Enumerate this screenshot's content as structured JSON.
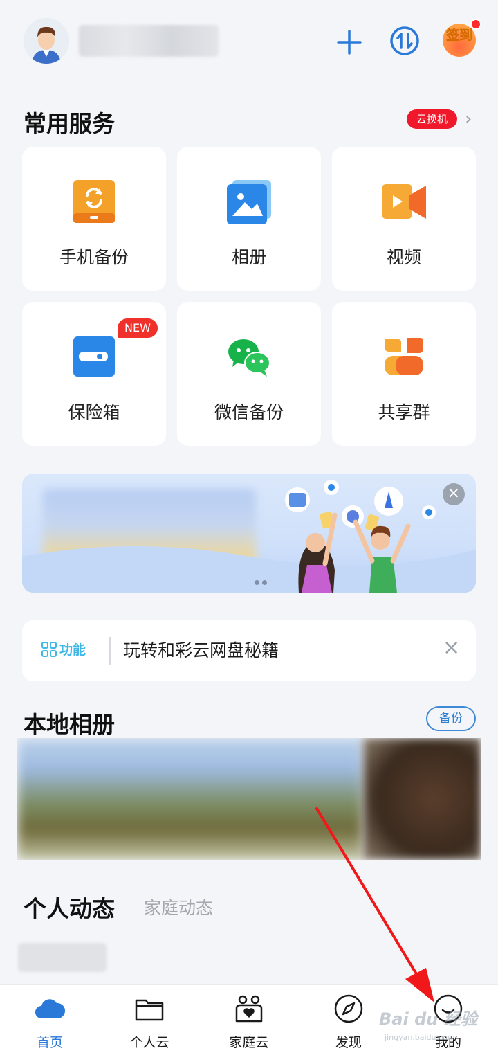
{
  "header": {
    "sign_label": "签到"
  },
  "services": {
    "title": "常用服务",
    "badge": "云换机",
    "items": [
      {
        "label": "手机备份",
        "icon": "phone-backup-icon"
      },
      {
        "label": "相册",
        "icon": "album-icon"
      },
      {
        "label": "视频",
        "icon": "video-icon"
      },
      {
        "label": "保险箱",
        "icon": "safe-icon",
        "badge": "NEW"
      },
      {
        "label": "微信备份",
        "icon": "wechat-icon"
      },
      {
        "label": "共享群",
        "icon": "share-group-icon"
      }
    ]
  },
  "tip": {
    "tag": "功能",
    "text": "玩转和彩云网盘秘籍"
  },
  "local_album": {
    "title": "本地相册",
    "backup_label": "备份"
  },
  "activity": {
    "tab_personal": "个人动态",
    "tab_family": "家庭动态"
  },
  "bottom_nav": [
    {
      "label": "首页",
      "icon": "cloud-icon",
      "active": true
    },
    {
      "label": "个人云",
      "icon": "folder-icon",
      "active": false
    },
    {
      "label": "家庭云",
      "icon": "family-icon",
      "active": false
    },
    {
      "label": "发现",
      "icon": "compass-icon",
      "active": false
    },
    {
      "label": "我的",
      "icon": "profile-icon",
      "active": false
    }
  ],
  "watermark": {
    "main": "Bai du 经验",
    "sub": "jingyan.baidu.com"
  },
  "colors": {
    "accent": "#2a78d8",
    "badge_red": "#f0192b",
    "background": "#f3f5f9"
  }
}
